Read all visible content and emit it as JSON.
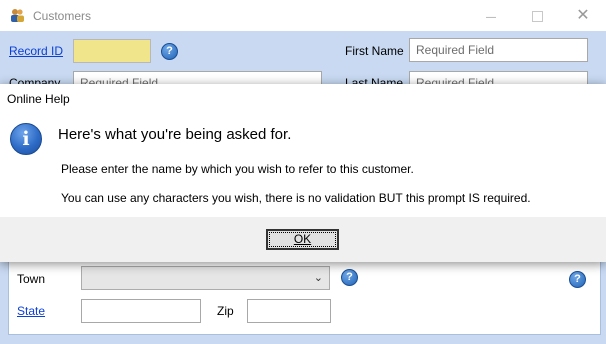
{
  "window": {
    "title": "Customers",
    "close_glyph": "✕",
    "minimize_glyph": "—"
  },
  "form": {
    "record_id_label": "Record ID",
    "first_name_label": "First Name",
    "first_name_placeholder": "Required Field",
    "company_label": "Company",
    "company_placeholder": "Required Field",
    "last_name_label": "Last Name",
    "last_name_placeholder": "Required Field",
    "town_label": "Town",
    "state_label": "State",
    "zip_label": "Zip",
    "help_glyph": "?"
  },
  "dialog": {
    "title": "Online Help",
    "icon_glyph": "i",
    "heading": "Here's what you're being asked for.",
    "line1": "Please enter the name by which you wish to refer to this customer.",
    "line2": "You can use any characters you wish, there is no validation BUT this prompt IS required.",
    "ok_label": "OK"
  },
  "colors": {
    "form_background": "#c8d9f1",
    "record_id_field": "#f1e58b",
    "link": "#0b3fd6"
  },
  "icons": [
    "app-people-icon",
    "help-icon",
    "info-icon",
    "chevron-down-icon",
    "close-icon",
    "minimize-icon",
    "maximize-icon"
  ]
}
